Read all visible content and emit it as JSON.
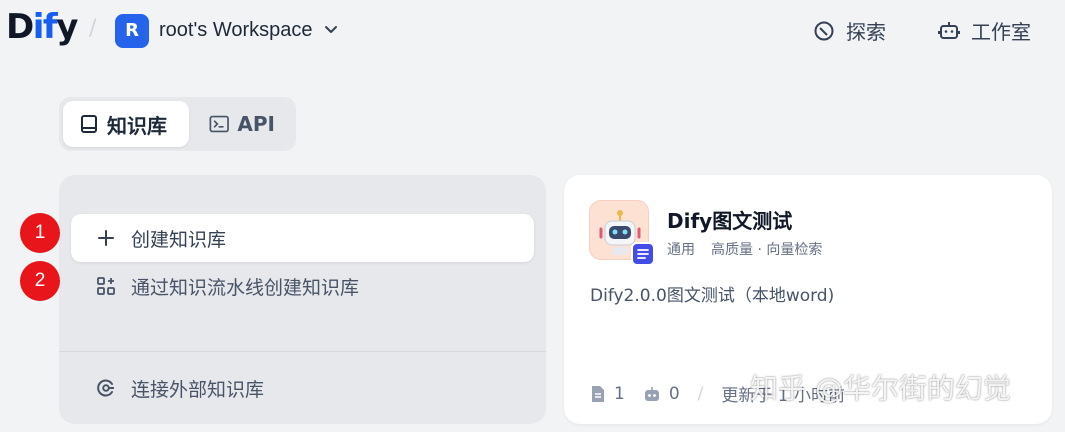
{
  "header": {
    "logo": {
      "prefix": "D",
      "accent": "if",
      "suffix": "y"
    },
    "workspace": {
      "initial": "R",
      "name": "root's Workspace"
    },
    "nav": [
      {
        "label": "探索",
        "icon": "explore-icon"
      },
      {
        "label": "工作室",
        "icon": "robot-icon"
      }
    ]
  },
  "tabs": [
    {
      "label": "知识库",
      "icon": "book-icon",
      "active": true
    },
    {
      "label": "API",
      "icon": "terminal-icon",
      "active": false
    }
  ],
  "create_panel": {
    "create_label": "创建知识库",
    "pipeline_label": "通过知识流水线创建知识库",
    "external_label": "连接外部知识库"
  },
  "annotations": {
    "badge_1": "1",
    "badge_2": "2"
  },
  "dataset_card": {
    "title": "Dify图文测试",
    "tag": "通用",
    "mode": "高质量 · 向量检索",
    "description": "Dify2.0.0图文测试（本地word)",
    "doc_count": "1",
    "app_count": "0",
    "updated": "更新于 1 小时前"
  },
  "watermark": "知乎 @华尔街的幻觉",
  "colors": {
    "accent": "#155eef",
    "badge": "#e8161b",
    "workspace_avatar": "#2563eb"
  }
}
